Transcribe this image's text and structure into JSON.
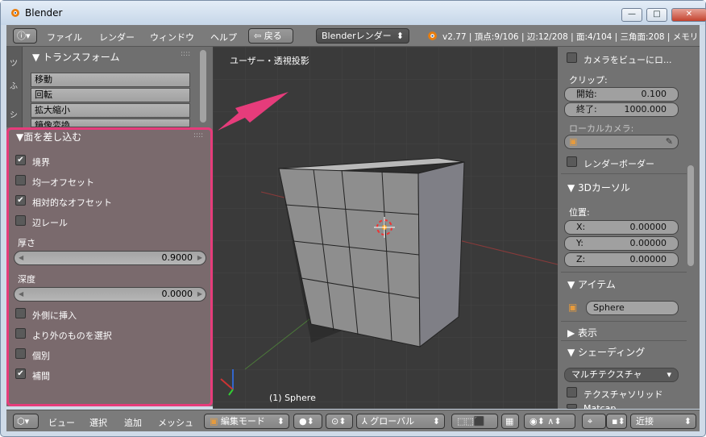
{
  "window": {
    "title": "Blender"
  },
  "titlebar": {
    "minimize": "—",
    "maximize": "□",
    "close": "✕"
  },
  "menubar": {
    "menus": [
      "ファイル",
      "レンダー",
      "ウィンドウ",
      "ヘルプ"
    ],
    "back_label": "戻る",
    "engine": "Blenderレンダー",
    "stats": "v2.77 | 頂点:9/106 | 辺:12/208 | 面:4/104 | 三角面:208 | メモリ"
  },
  "tool_panel": {
    "title": "トランスフォーム",
    "buttons": [
      "移動",
      "回転",
      "拡大縮小",
      "鏡像変換"
    ]
  },
  "operator_panel": {
    "title": "面を差し込む",
    "options": [
      {
        "label": "境界",
        "checked": true
      },
      {
        "label": "均一オフセット",
        "checked": false
      },
      {
        "label": "相対的なオフセット",
        "checked": true
      },
      {
        "label": "辺レール",
        "checked": false
      }
    ],
    "thickness_label": "厚さ",
    "thickness_value": "0.9000",
    "depth_label": "深度",
    "depth_value": "0.0000",
    "options2": [
      {
        "label": "外側に挿入",
        "checked": false
      },
      {
        "label": "より外のものを選択",
        "checked": false
      },
      {
        "label": "個別",
        "checked": false
      },
      {
        "label": "補間",
        "checked": true
      }
    ]
  },
  "viewport": {
    "title": "ユーザー・透視投影",
    "object_label": "(1) Sphere"
  },
  "properties": {
    "lock_camera": "カメラをビューにロ...",
    "clip_label": "クリップ:",
    "clip_start_label": "開始:",
    "clip_start_value": "0.100",
    "clip_end_label": "終了:",
    "clip_end_value": "1000.000",
    "local_camera_label": "ローカルカメラ:",
    "render_border": "レンダーボーダー",
    "cursor_title": "3Dカーソル",
    "position_label": "位置:",
    "cursor_x_label": "X:",
    "cursor_x": "0.00000",
    "cursor_y_label": "Y:",
    "cursor_y": "0.00000",
    "cursor_z_label": "Z:",
    "cursor_z": "0.00000",
    "item_title": "アイテム",
    "item_name": "Sphere",
    "display_title": "表示",
    "shading_title": "シェーディング",
    "shading_mode": "マルチテクスチャ",
    "texture_solid": "テクスチャソリッド",
    "matcap": "Matcap"
  },
  "bottombar": {
    "menus": [
      "ビュー",
      "選択",
      "追加",
      "メッシュ"
    ],
    "mode": "編集モード",
    "orientation": "グローバル",
    "snap": "近接"
  },
  "colors": {
    "highlight": "#e63c7b",
    "panel": "#727272",
    "viewport": "#3a3a3a"
  }
}
